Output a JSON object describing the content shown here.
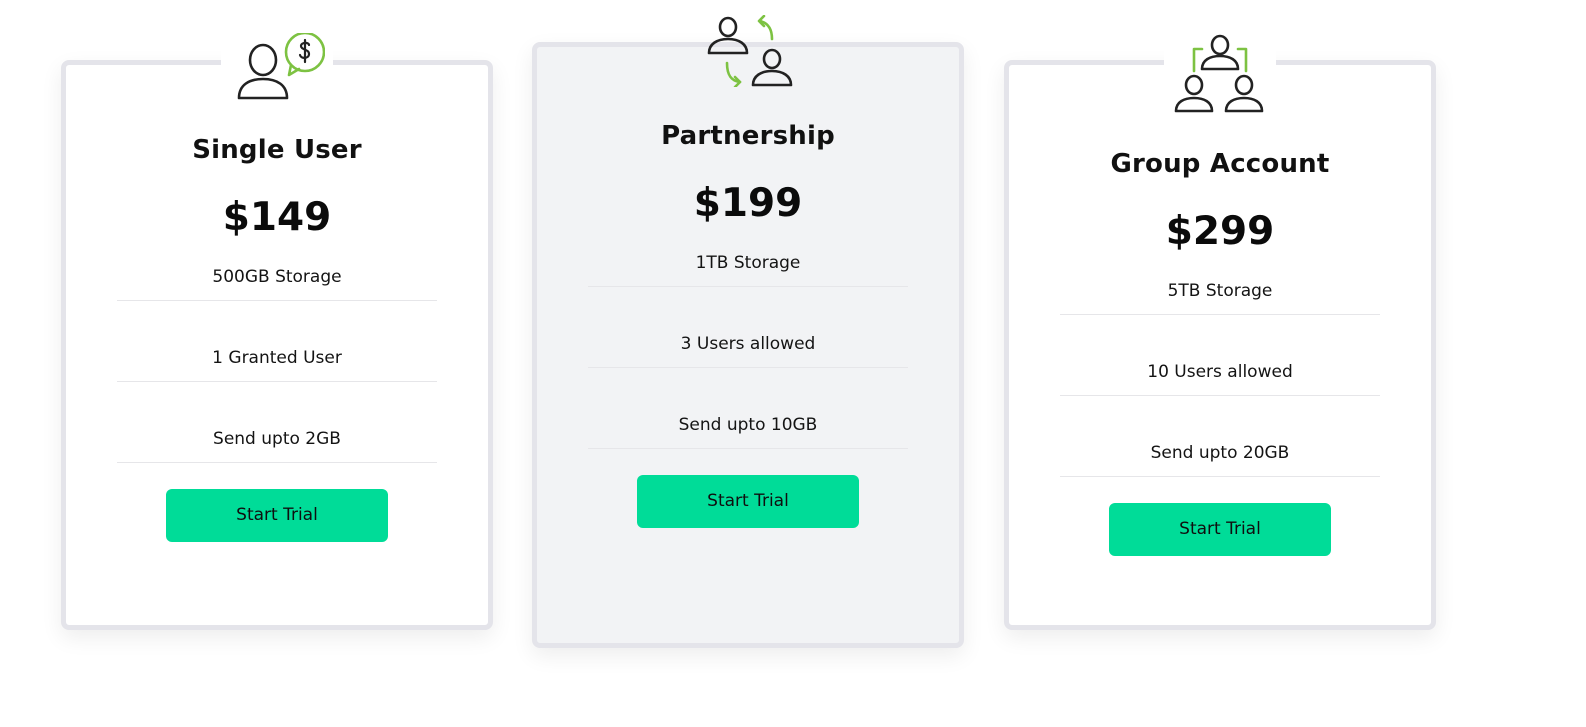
{
  "accent_color": "#00dc98",
  "icon_accent_color": "#7dc242",
  "plans": [
    {
      "name": "Single User",
      "price": "$149",
      "icon": "single-user-dollar-icon",
      "features": [
        "500GB Storage",
        "1 Granted User",
        "Send upto 2GB"
      ],
      "button_label": "Start Trial",
      "featured": false
    },
    {
      "name": "Partnership",
      "price": "$199",
      "icon": "partnership-exchange-icon",
      "features": [
        "1TB Storage",
        "3 Users allowed",
        "Send upto 10GB"
      ],
      "button_label": "Start Trial",
      "featured": true
    },
    {
      "name": "Group Account",
      "price": "$299",
      "icon": "group-account-icon",
      "features": [
        "5TB Storage",
        "10 Users allowed",
        "Send upto 20GB"
      ],
      "button_label": "Start Trial",
      "featured": false
    }
  ]
}
